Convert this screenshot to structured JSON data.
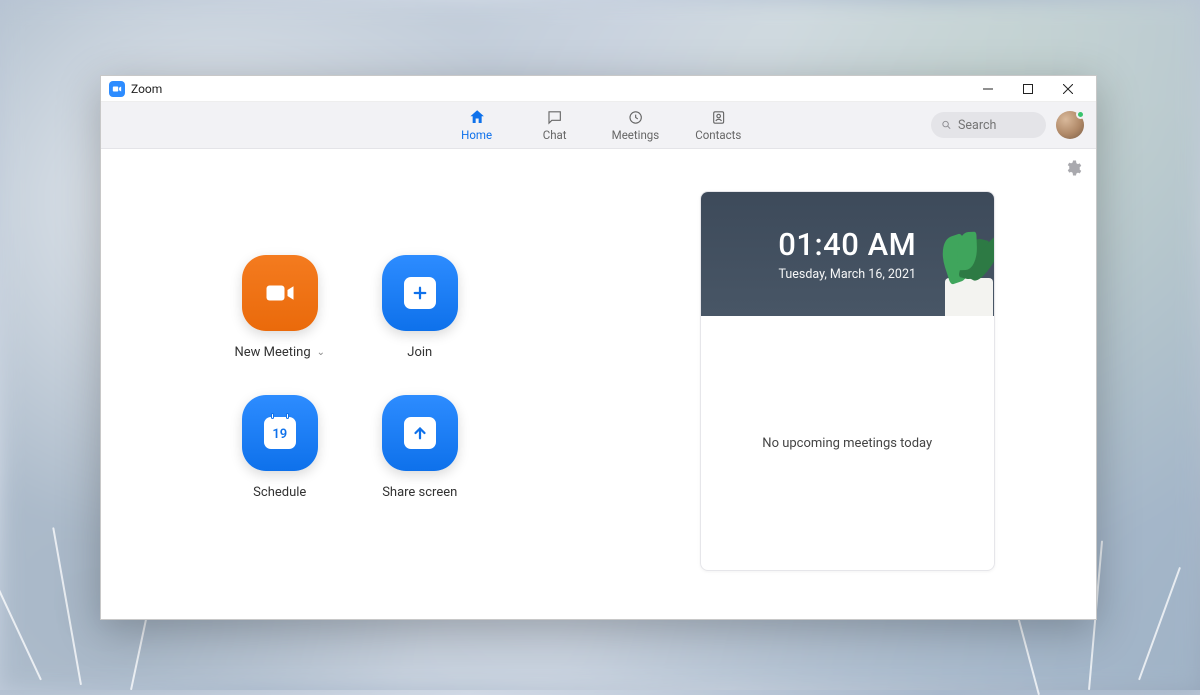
{
  "app": {
    "title": "Zoom"
  },
  "tabs": {
    "home": "Home",
    "chat": "Chat",
    "meetings": "Meetings",
    "contacts": "Contacts"
  },
  "search": {
    "placeholder": "Search"
  },
  "actions": {
    "new_meeting": "New Meeting",
    "join": "Join",
    "schedule": "Schedule",
    "schedule_day": "19",
    "share_screen": "Share screen"
  },
  "clock": {
    "time": "01:40 AM",
    "date": "Tuesday, March 16, 2021"
  },
  "meetings": {
    "empty_message": "No upcoming meetings today"
  }
}
